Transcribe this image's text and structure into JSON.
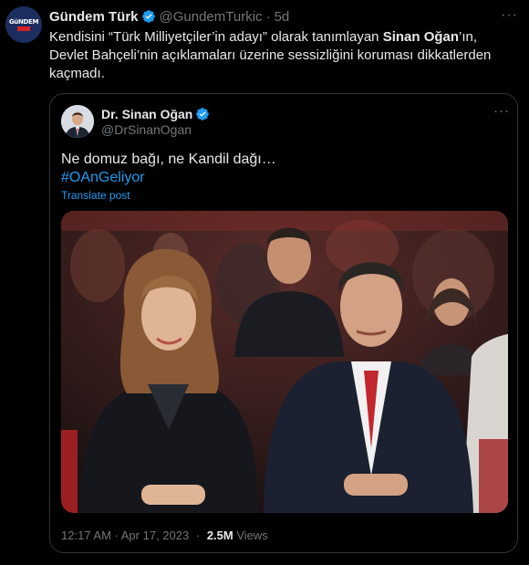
{
  "author": {
    "name": "Gündem Türk",
    "handle": "@GundemTurkic",
    "separator": "·",
    "time": "5d",
    "avatar_text": "GüNDEM TÜRK"
  },
  "tweet": {
    "part1": "Kendisini “Türk Milliyetçiler’in adayı” olarak tanımlayan ",
    "bold": "Sinan Oğan",
    "part2": "’ın, Devlet Bahçeli’nin açıklamaları üzerine sessizliğini koruması dikkatlerden kaçmadı."
  },
  "quoted": {
    "name": "Dr. Sinan Oğan",
    "handle": "@DrSinanOgan",
    "text": "Ne domuz bağı, ne Kandil dağı…",
    "hashtag": "#OAnGeliyor",
    "translate": "Translate post",
    "time": "12:17 AM · Apr 17, 2023",
    "separator": "·",
    "views_count": "2.5M",
    "views_label": "Views"
  },
  "icons": {
    "verified": "verified-badge-icon",
    "more": "more-icon"
  },
  "colors": {
    "background": "#000000",
    "text": "#e7e9ea",
    "muted": "#71767b",
    "link": "#1d9bf0",
    "border": "#2f3336"
  }
}
